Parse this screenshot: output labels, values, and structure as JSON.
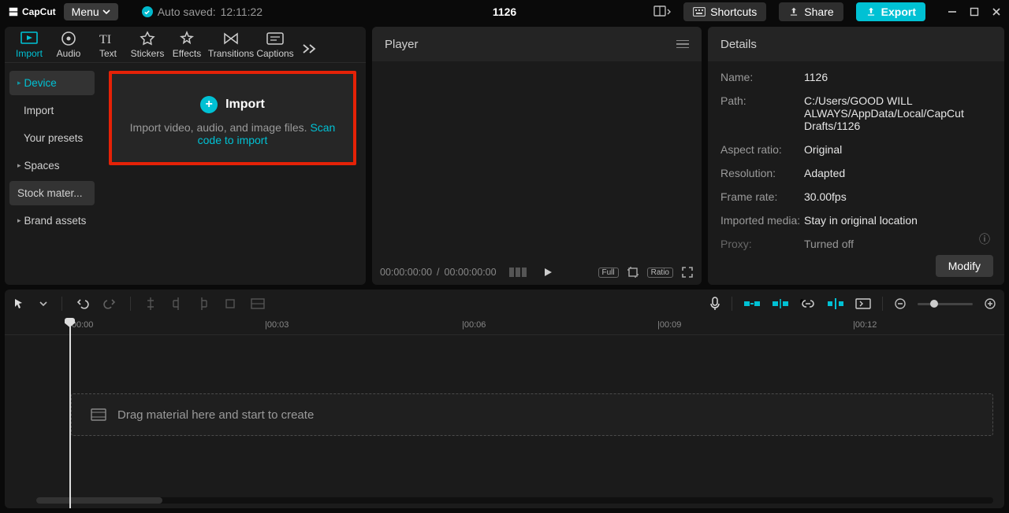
{
  "app": {
    "name": "CapCut"
  },
  "topbar": {
    "menu_label": "Menu",
    "autosave_prefix": "Auto saved:",
    "autosave_time": "12:11:22",
    "project_title": "1126",
    "shortcuts_label": "Shortcuts",
    "share_label": "Share",
    "export_label": "Export"
  },
  "left_tabs": {
    "more_tooltip": "More",
    "items": [
      {
        "id": "import",
        "label": "Import"
      },
      {
        "id": "audio",
        "label": "Audio"
      },
      {
        "id": "text",
        "label": "Text"
      },
      {
        "id": "stickers",
        "label": "Stickers"
      },
      {
        "id": "effects",
        "label": "Effects"
      },
      {
        "id": "transitions",
        "label": "Transitions"
      },
      {
        "id": "captions",
        "label": "Captions"
      }
    ]
  },
  "sidebar": {
    "items": [
      {
        "id": "device",
        "label": "Device",
        "active": true,
        "caret": true
      },
      {
        "id": "import",
        "label": "Import",
        "sub": true
      },
      {
        "id": "presets",
        "label": "Your presets",
        "sub": true
      },
      {
        "id": "spaces",
        "label": "Spaces",
        "caret": true
      },
      {
        "id": "stock",
        "label": "Stock mater..."
      },
      {
        "id": "brand",
        "label": "Brand assets",
        "caret": true
      }
    ]
  },
  "import": {
    "title": "Import",
    "subtitle_a": "Import video, audio, and image files. ",
    "link": "Scan code to import"
  },
  "player": {
    "title": "Player",
    "time_current": "00:00:00:00",
    "time_sep": " / ",
    "time_total": "00:00:00:00",
    "full_label": "Full",
    "ratio_label": "Ratio"
  },
  "details": {
    "title": "Details",
    "rows": [
      {
        "label": "Name:",
        "value": "1126"
      },
      {
        "label": "Path:",
        "value": "C:/Users/GOOD WILL ALWAYS/AppData/Local/CapCut Drafts/1126"
      },
      {
        "label": "Aspect ratio:",
        "value": "Original"
      },
      {
        "label": "Resolution:",
        "value": "Adapted"
      },
      {
        "label": "Frame rate:",
        "value": "30.00fps"
      },
      {
        "label": "Imported media:",
        "value": "Stay in original location"
      },
      {
        "label": "Proxy:",
        "value": "Turned off"
      }
    ],
    "modify_label": "Modify"
  },
  "timeline": {
    "marks": [
      "|00:00",
      "|00:03",
      "|00:06",
      "|00:09",
      "|00:12"
    ],
    "drop_hint": "Drag material here and start to create"
  }
}
